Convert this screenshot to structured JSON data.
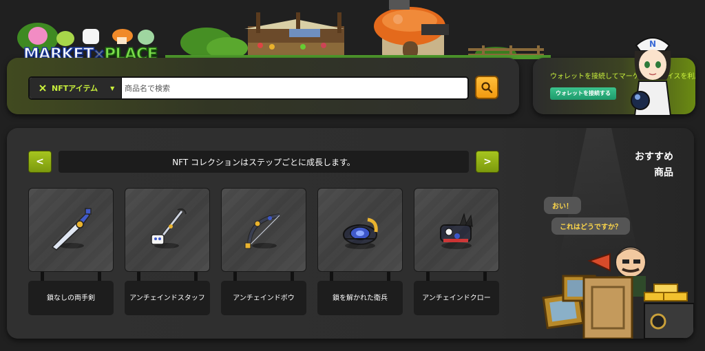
{
  "logo": {
    "line1": "MARKET",
    "line2": "PLACE"
  },
  "search": {
    "category_label": "NFTアイテム",
    "placeholder": "商品名で検索"
  },
  "wallet": {
    "prompt_text": "ウォレットを接続してマーケットプレイスを利用しましょう",
    "connect_label": "ウォレットを接続する"
  },
  "collection": {
    "banner_text": "NFT コレクションはステップごとに成長します。",
    "prev_symbol": "<",
    "next_symbol": ">",
    "items": [
      {
        "name": "鎖なしの両手剣",
        "icon": "two-handed-sword"
      },
      {
        "name": "アンチェインドスタッフ",
        "icon": "staff"
      },
      {
        "name": "アンチェインドボウ",
        "icon": "bow"
      },
      {
        "name": "鎖を解かれた衛兵",
        "icon": "guard-gauntlet"
      },
      {
        "name": "アンチェインドクロー",
        "icon": "claw"
      }
    ]
  },
  "recommended": {
    "title_line1": "おすすめ",
    "title_line2": "商品",
    "speech1": "おい！",
    "speech2": "これはどうですか？"
  },
  "colors": {
    "accent_green": "#a6c51f",
    "accent_lime_text": "#c9f03c",
    "search_button": "#f5a623",
    "wallet_button": "#2bb07d",
    "speech_text": "#ffd84a"
  }
}
